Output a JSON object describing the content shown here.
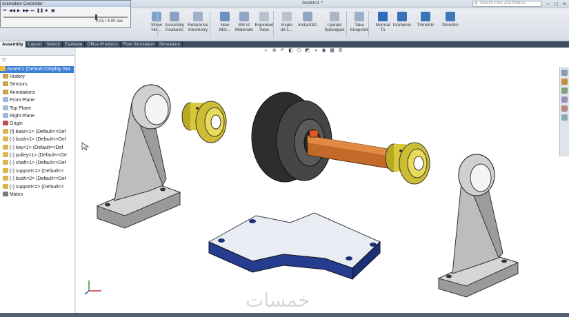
{
  "animation_controller": {
    "title": "Animation Controller",
    "time": "0.01 / 4.00 sec",
    "progress": 0.75,
    "buttons": [
      "start-icon",
      "rewind-icon",
      "play-icon",
      "fast-forward-icon",
      "end-icon",
      "pause-icon",
      "stop-icon",
      "save-icon"
    ]
  },
  "window": {
    "doc_title": "Assem1 *",
    "search_placeholder": "Search Files and Models",
    "min": "–",
    "max": "□",
    "close": "×"
  },
  "toolbar": {
    "items": [
      {
        "label": "Show\nHid...",
        "color": "#7fa3cf"
      },
      {
        "label": "Assembly\nFeatures",
        "color": "#8aa0c0"
      },
      {
        "label": "Reference\nGeometry",
        "color": "#a0b0c8"
      },
      {
        "label": "New\nMot...",
        "color": "#6b8fbf"
      },
      {
        "label": "Bill of\nMaterials",
        "color": "#90a6c4"
      },
      {
        "label": "Exploded\nView",
        "color": "#b7c2d0"
      },
      {
        "label": "Explo\nde L...",
        "color": "#b7c2d0"
      },
      {
        "label": "Instant3D",
        "color": "#8fa7c5"
      },
      {
        "label": "Update\nSpeedpak",
        "color": "#a9b6c8"
      },
      {
        "label": "Take\nSnapshot",
        "color": "#9eb0c6"
      },
      {
        "label": "Normal\nTo",
        "color": "#2f6db8"
      },
      {
        "label": "Isometric",
        "color": "#3670b6"
      },
      {
        "label": "Trimetric",
        "color": "#3b73b8"
      },
      {
        "label": "Dimetric",
        "color": "#3f77bb"
      }
    ]
  },
  "tabs": [
    "Assembly",
    "Layout",
    "Sketch",
    "Evaluate",
    "Office Products",
    "Flow Simulation",
    "Simulation"
  ],
  "tree": {
    "root": "Assem1  (Default<Display Sta",
    "nodes": [
      {
        "label": "History",
        "color": "#c9a24a"
      },
      {
        "label": "Sensors",
        "color": "#c9a24a"
      },
      {
        "label": "Annotations",
        "color": "#c9a24a"
      },
      {
        "label": "Front Plane",
        "color": "#9fb8d8"
      },
      {
        "label": "Top Plane",
        "color": "#9fb8d8"
      },
      {
        "label": "Right Plane",
        "color": "#9fb8d8"
      },
      {
        "label": "Origin",
        "color": "#c05050"
      },
      {
        "label": "(f) base<1> (Default<<Def",
        "color": "#d8b64a"
      },
      {
        "label": "(-) bush<1> (Default<<Def",
        "color": "#d8b64a"
      },
      {
        "label": "(-) key<1> (Default<<Def",
        "color": "#d8b64a"
      },
      {
        "label": "(-) pulley<1> (Default<<De",
        "color": "#d8b64a"
      },
      {
        "label": "(-) shaft<1> (Default<<Def",
        "color": "#d8b64a"
      },
      {
        "label": "(-) support<1> (Default<<",
        "color": "#d8b64a"
      },
      {
        "label": "(-) bush<2> (Default<<Def",
        "color": "#d8b64a"
      },
      {
        "label": "(-) support<2> (Default<<",
        "color": "#d8b64a"
      },
      {
        "label": "Mates",
        "color": "#777777"
      }
    ]
  },
  "hud_icons": [
    "zoom-fit-icon",
    "zoom-area-icon",
    "previous-view-icon",
    "section-view-icon",
    "view-orientation-icon",
    "display-style-icon",
    "hide-show-icon",
    "edit-appearance-icon",
    "scene-icon",
    "view-settings-icon"
  ],
  "watermark": "خمسات",
  "colors": {
    "support": "#c9c9c9",
    "bush": "#d9c83a",
    "pulley": "#3c3c3c",
    "shaft": "#c26a2a",
    "base_top": "#e9edf3",
    "base_side": "#263c8f",
    "selection": "#3b7fd6"
  }
}
